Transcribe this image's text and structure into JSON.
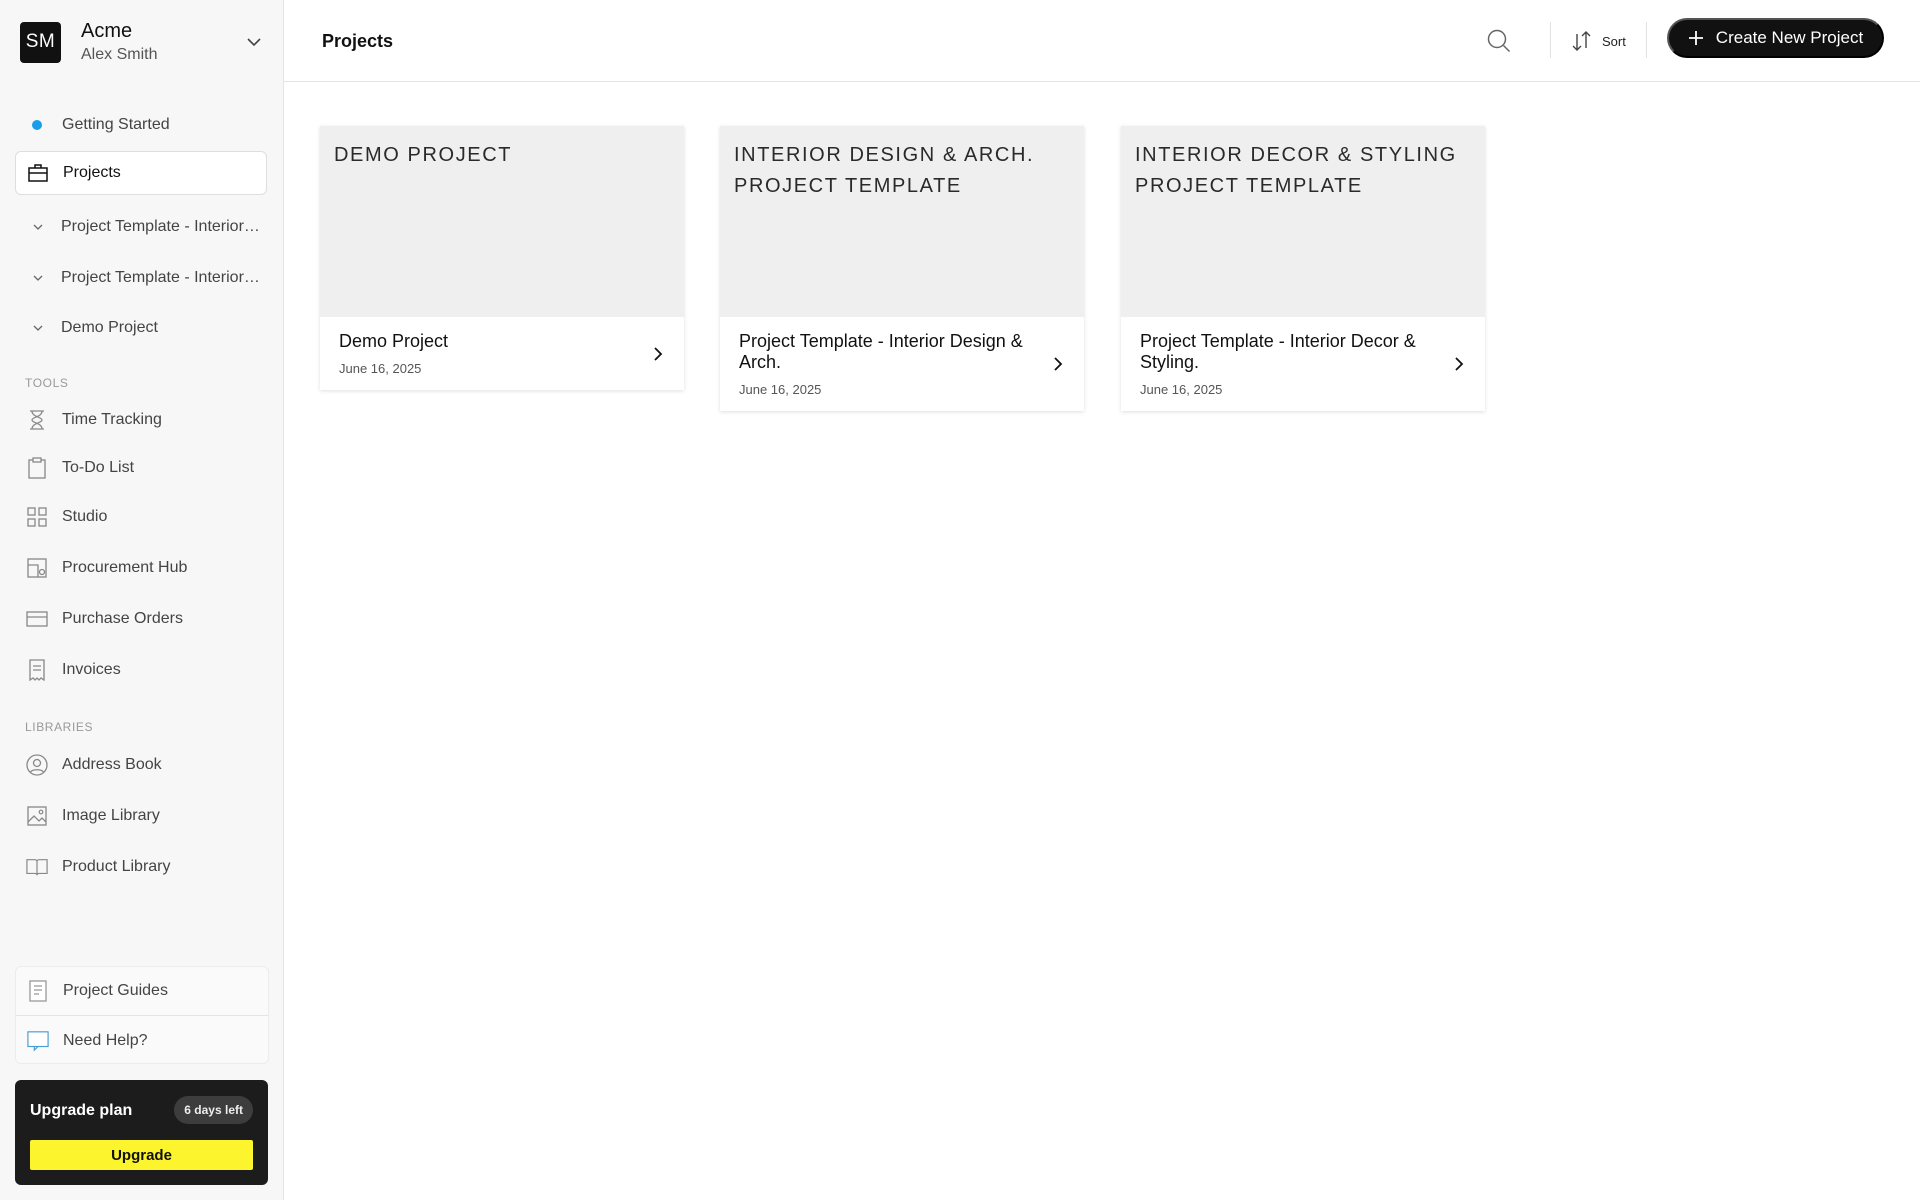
{
  "workspace": {
    "initials": "SM",
    "name": "Acme",
    "user": "Alex Smith"
  },
  "sidebar": {
    "getting_started": "Getting Started",
    "projects": "Projects",
    "project_items": [
      {
        "label": "Project Template - Interior Design & Arch."
      },
      {
        "label": "Project Template - Interior Decor & Styling."
      },
      {
        "label": "Demo Project"
      }
    ],
    "tools_label": "TOOLS",
    "tools": [
      {
        "label": "Time Tracking",
        "icon": "hourglass-icon"
      },
      {
        "label": "To-Do List",
        "icon": "clipboard-icon"
      },
      {
        "label": "Studio",
        "icon": "grid-icon"
      },
      {
        "label": "Procurement Hub",
        "icon": "procurement-icon"
      },
      {
        "label": "Purchase Orders",
        "icon": "card-icon"
      },
      {
        "label": "Invoices",
        "icon": "receipt-icon"
      }
    ],
    "libraries_label": "LIBRARIES",
    "libraries": [
      {
        "label": "Address Book",
        "icon": "user-circle-icon"
      },
      {
        "label": "Image Library",
        "icon": "image-icon"
      },
      {
        "label": "Product Library",
        "icon": "book-icon"
      }
    ],
    "guides": "Project Guides",
    "help": "Need Help?",
    "upgrade": {
      "title": "Upgrade plan",
      "badge": "6 days left",
      "button": "Upgrade"
    }
  },
  "header": {
    "title": "Projects",
    "sort_label": "Sort",
    "create_label": "Create New Project"
  },
  "projects": [
    {
      "cover": "Demo Project",
      "title": "Demo Project",
      "date": "June 16, 2025"
    },
    {
      "cover": "Interior Design & Arch. Project Template",
      "title": "Project Template - Interior Design & Arch.",
      "date": "June 16, 2025"
    },
    {
      "cover": "Interior Decor & Styling Project Template",
      "title": "Project Template - Interior Decor & Styling.",
      "date": "June 16, 2025"
    }
  ],
  "colors": {
    "accent_dot": "#1a9ee8",
    "upgrade_button": "#fcf52d",
    "primary": "#111111"
  }
}
